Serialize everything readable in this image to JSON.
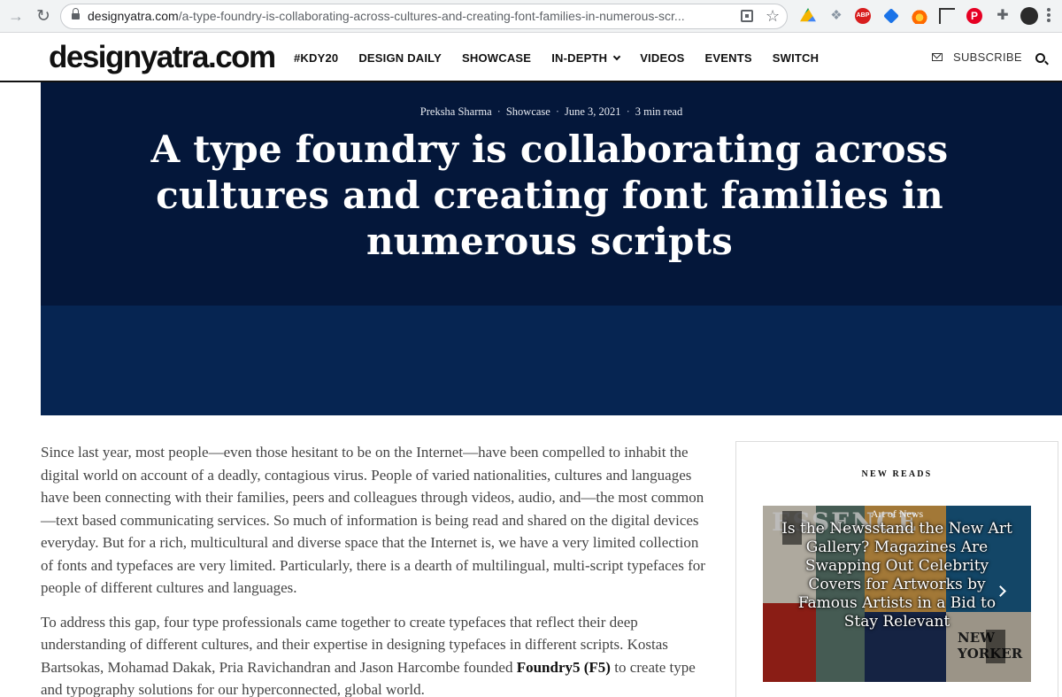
{
  "browser": {
    "url_domain": "designyatra.com",
    "url_path": "/a-type-foundry-is-collaborating-across-cultures-and-creating-font-families-in-numerous-scr...",
    "extensions": [
      "drive-icon",
      "dropbox-icon",
      "adblock-icon",
      "feather-icon",
      "fire-icon",
      "crop-icon",
      "pinterest-icon",
      "puzzle-icon"
    ],
    "abp_label": "ABP"
  },
  "header": {
    "logo": "designyatra.com",
    "nav": [
      "#KDY20",
      "DESIGN DAILY",
      "SHOWCASE",
      "IN-DEPTH",
      "VIDEOS",
      "EVENTS",
      "SWITCH"
    ],
    "subscribe": "SUBSCRIBE"
  },
  "hero": {
    "author": "Preksha Sharma",
    "category": "Showcase",
    "date": "June 3, 2021",
    "read_time": "3 min read",
    "title": "A type foundry is collaborating across cultures and creating font families in numerous scripts"
  },
  "article": {
    "paragraph_1": "Since last year, most people—even those hesitant to be on the Internet—have been compelled to inhabit the digital world on account of a deadly, contagious virus. People of varied nationalities, cultures and languages have been connecting with their families, peers and colleagues through videos, audio, and—the most common—text based communicating services. So much of information is being read and shared on the digital devices everyday. But for a rich, multicultural and diverse space that the Internet is, we have a very limited collection of fonts and typefaces are very limited. Particularly, there is a dearth of multilingual, multi-script typefaces for people of different cultures and languages.",
    "paragraph_2_start": "To address this gap, four type professionals came together to create typefaces that reflect their deep understanding of different cultures, and their expertise in designing typefaces in different scripts. Kostas Bartsokas, Mohamad Dakak, Pria Ravichandran and Jason Harcombe founded ",
    "paragraph_2_bold": "Foundry5 (F5)",
    "paragraph_2_end": " to create type and typography solutions for our hyperconnected, global world."
  },
  "sidebar": {
    "widget_title": "NEW READS",
    "card_category": "Art of News",
    "card_title": "Is the Newsstand the New Art Gallery? Magazines Are Swapping Out Celebrity Covers for Artworks by Famous Artists in a Bid to Stay Relevant",
    "cover_text_1": "ESSENCE",
    "cover_text_2": "NEW YORKER"
  }
}
